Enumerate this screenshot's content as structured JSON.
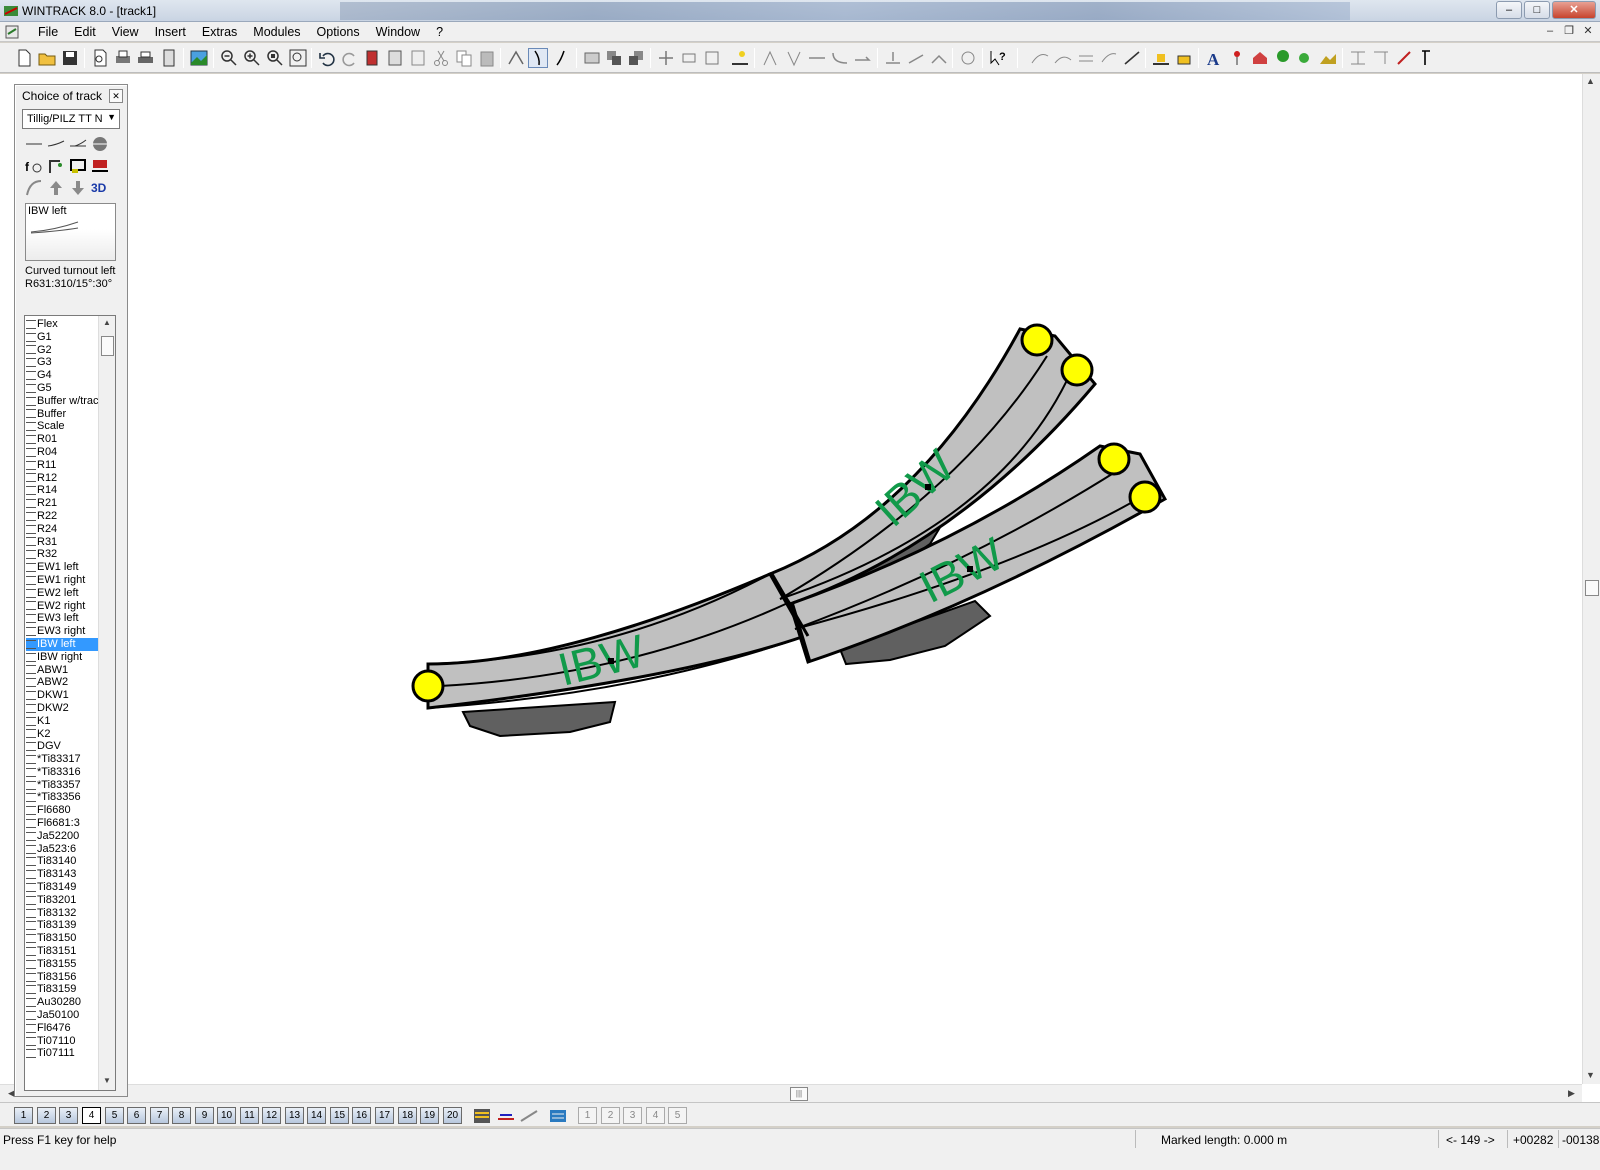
{
  "window": {
    "title": "WINTRACK 8.0 - [track1]",
    "controls": {
      "minimize": "–",
      "maximize": "□",
      "close": "✕"
    }
  },
  "menu": {
    "items": [
      "File",
      "Edit",
      "View",
      "Insert",
      "Extras",
      "Modules",
      "Options",
      "Window",
      "?"
    ],
    "mdi_controls": {
      "minimize": "–",
      "restore": "❐",
      "close": "✕"
    }
  },
  "track_panel": {
    "title": "Choice of track",
    "close": "✕",
    "manufacturer": "Tillig/PILZ TT N",
    "icon_3d": "3D",
    "preview_name": "IBW left",
    "description_line1": "Curved turnout left",
    "description_line2": "R631:310/15°:30°",
    "items": [
      "Flex",
      "G1",
      "G2",
      "G3",
      "G4",
      "G5",
      "Buffer w/track",
      "Buffer",
      "Scale",
      "R01",
      "R04",
      "R11",
      "R12",
      "R14",
      "R21",
      "R22",
      "R24",
      "R31",
      "R32",
      "EW1 left",
      "EW1 right",
      "EW2 left",
      "EW2 right",
      "EW3 left",
      "EW3 right",
      "IBW left",
      "IBW right",
      "ABW1",
      "ABW2",
      "DKW1",
      "DKW2",
      "K1",
      "K2",
      "DGV",
      "*Ti83317",
      "*Ti83316",
      "*Ti83357",
      "*Ti83356",
      "Fl6680",
      "Fl6681:3",
      "Ja52200",
      "Ja523:6",
      "Ti83140",
      "Ti83143",
      "Ti83149",
      "Ti83201",
      "Ti83132",
      "Ti83139",
      "Ti83150",
      "Ti83151",
      "Ti83155",
      "Ti83156",
      "Ti83159",
      "Au30280",
      "Ja50100",
      "Fl6476",
      "Ti07110",
      "Ti07111"
    ],
    "selected": "IBW left"
  },
  "canvas": {
    "track_labels": [
      "IBW",
      "IBW",
      "IBW"
    ],
    "colors": {
      "track": "#c0c0c0",
      "shadow": "#606060",
      "endpoint": "#ffff00",
      "label": "#119a4a"
    }
  },
  "layers": {
    "numbers": [
      "1",
      "2",
      "3",
      "4",
      "5",
      "6",
      "7",
      "8",
      "9",
      "10",
      "11",
      "12",
      "13",
      "14",
      "15",
      "16",
      "17",
      "18",
      "19",
      "20"
    ],
    "active": "4",
    "sub_layers": [
      "1",
      "2",
      "3",
      "4",
      "5"
    ]
  },
  "status": {
    "help": "Press F1 key for help",
    "marked_length": "Marked length: 0.000 m",
    "angle": "<- 149 ->",
    "x": "+00282",
    "y": "-00138"
  }
}
